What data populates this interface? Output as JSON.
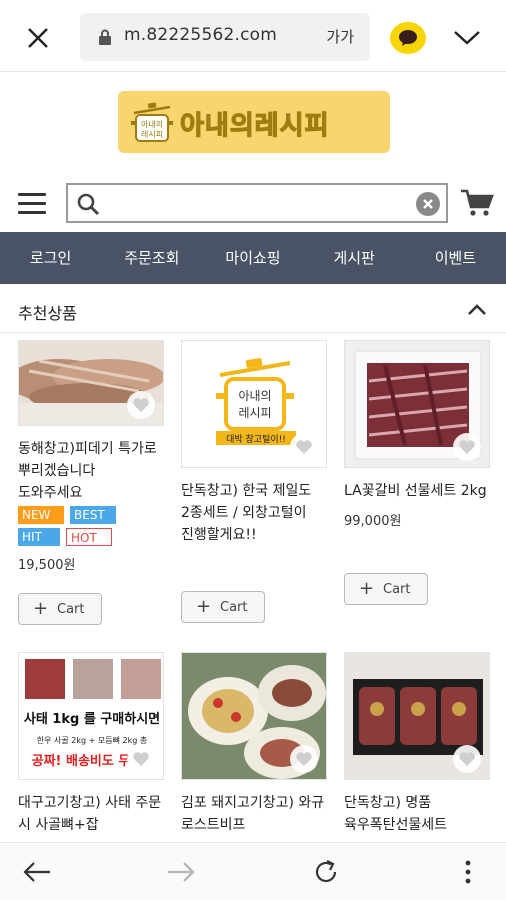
{
  "browser": {
    "url": "m.82225562.com",
    "font_size_label": "가가"
  },
  "site": {
    "logo_text": "아내의레시피",
    "search": {
      "placeholder": ""
    },
    "nav": [
      "로그인",
      "주문조회",
      "마이쇼핑",
      "게시판",
      "이벤트"
    ]
  },
  "section": {
    "title": "추천상품"
  },
  "products": [
    {
      "name": "동해창고)피데기 특가로 뿌리겠습니다 도와주세요",
      "badges": [
        "NEW",
        "BEST",
        "HIT",
        "HOT"
      ],
      "price": "19,500원",
      "cart_label": "Cart"
    },
    {
      "name": "단독창고) 한국 제일도 2종세트 / 외창고털이 진행할게요!!",
      "image_caption_1": "아내의",
      "image_caption_2": "레시피",
      "image_banner": "대박 창고털이!!",
      "cart_label": "Cart"
    },
    {
      "name": "LA꽃갈비 선물세트 2kg",
      "price": "99,000원",
      "cart_label": "Cart"
    },
    {
      "name": "대구고기창고) 사태 주문 시 사골뼈+잡",
      "image_line_1": "사태 1kg 를 구매하시면",
      "image_line_2": "한우 사골 2kg + 모듬뼈 2kg 총",
      "image_line_3": "공짜! 배송비도 무"
    },
    {
      "name": "김포 돼지고기창고) 와규 로스트비프"
    },
    {
      "name": "단독창고) 명품 육우폭탄선물세트"
    }
  ],
  "colors": {
    "nav_bg": "#4a5366",
    "logo_bg": "#f7d66f",
    "kakao": "#f7d500",
    "badge_new": "#ff9d1a",
    "badge_blue": "#4aa8e8",
    "badge_hot": "#e04b4b"
  },
  "icons": [
    "close-icon",
    "lock-icon",
    "kakao-talk-icon",
    "chevron-down-icon",
    "hamburger-menu-icon",
    "search-icon",
    "clear-icon",
    "cart-icon",
    "collapse-icon",
    "heart-icon",
    "back-arrow-icon",
    "forward-arrow-icon",
    "refresh-icon",
    "more-icon"
  ]
}
